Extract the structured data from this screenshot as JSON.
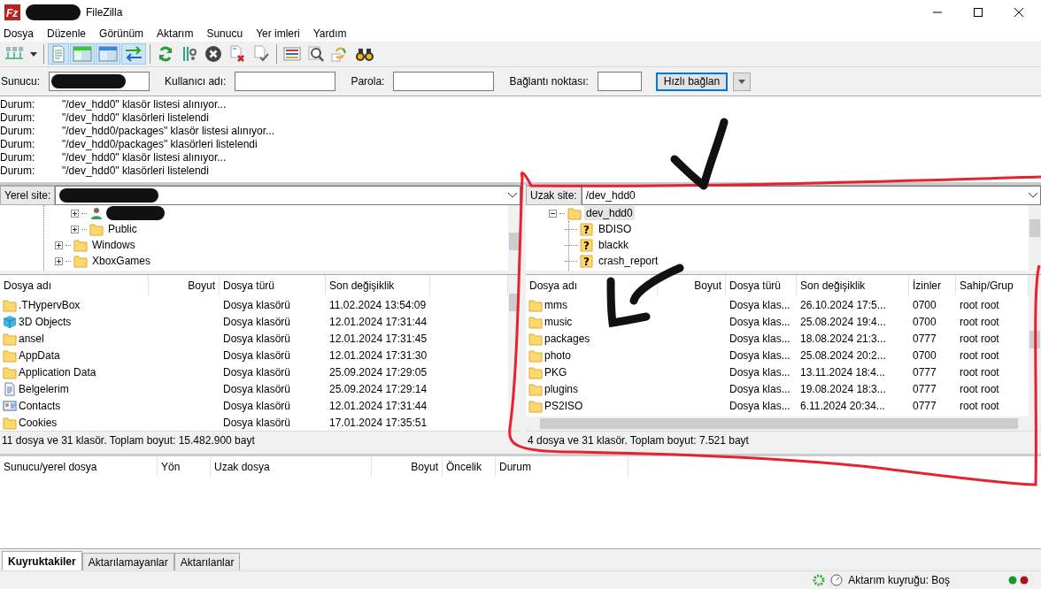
{
  "window": {
    "title": "FileZilla",
    "logo": "Fz"
  },
  "menu": [
    "Dosya",
    "Düzenle",
    "Görünüm",
    "Aktarım",
    "Sunucu",
    "Yer imleri",
    "Yardım"
  ],
  "toolbar": [
    {
      "kind": "sitemanager",
      "selected": false
    },
    {
      "kind": "dropdown",
      "selected": false
    },
    {
      "kind": "log",
      "selected": true
    },
    {
      "kind": "localtree",
      "selected": true
    },
    {
      "kind": "remotetree",
      "selected": true
    },
    {
      "kind": "queue",
      "selected": true
    },
    {
      "kind": "refresh",
      "selected": false
    },
    {
      "kind": "filter",
      "selected": false
    },
    {
      "kind": "cancel",
      "selected": false
    },
    {
      "kind": "disconnect",
      "selected": false
    },
    {
      "kind": "reconnect",
      "selected": false
    },
    {
      "kind": "listview",
      "selected": false
    },
    {
      "kind": "search",
      "selected": false
    },
    {
      "kind": "sync",
      "selected": false
    },
    {
      "kind": "binoculars",
      "selected": false
    }
  ],
  "quickconnect": {
    "fields": [
      {
        "label": "Sunucu:"
      },
      {
        "label": "Kullanıcı adı:"
      },
      {
        "label": "Parola:"
      },
      {
        "label": "Bağlantı noktası:"
      }
    ],
    "button": "Hızlı bağlan"
  },
  "log": [
    {
      "label": "Durum:",
      "text": "\"/dev_hdd0\" klasör listesi alınıyor..."
    },
    {
      "label": "Durum:",
      "text": "\"/dev_hdd0\" klasörleri listelendi"
    },
    {
      "label": "Durum:",
      "text": "\"/dev_hdd0/packages\" klasör listesi alınıyor..."
    },
    {
      "label": "Durum:",
      "text": "\"/dev_hdd0/packages\" klasörleri listelendi"
    },
    {
      "label": "Durum:",
      "text": "\"/dev_hdd0\" klasör listesi alınıyor..."
    },
    {
      "label": "Durum:",
      "text": "\"/dev_hdd0\" klasörleri listelendi"
    }
  ],
  "local": {
    "site_label": "Yerel site:",
    "tree": [
      {
        "children": [
          {
            "kind": "user",
            "expanded": false
          },
          {
            "label": "Public",
            "kind": "folder",
            "expanded": false
          }
        ]
      },
      {
        "label": "Windows",
        "kind": "folder",
        "expanded": false
      },
      {
        "label": "XboxGames",
        "kind": "folder",
        "expanded": false
      }
    ],
    "columns": [
      "Dosya adı",
      "Boyut",
      "Dosya türü",
      "Son değişiklik"
    ],
    "rows": [
      {
        "kind": "folder",
        "name": ".THypervBox",
        "size": "",
        "type": "Dosya klasörü",
        "modified": "11.02.2024 13:54:09"
      },
      {
        "kind": "cube",
        "name": "3D Objects",
        "size": "",
        "type": "Dosya klasörü",
        "modified": "12.01.2024 17:31:44"
      },
      {
        "kind": "folder",
        "name": "ansel",
        "size": "",
        "type": "Dosya klasörü",
        "modified": "12.01.2024 17:31:45"
      },
      {
        "kind": "folder",
        "name": "AppData",
        "size": "",
        "type": "Dosya klasörü",
        "modified": "12.01.2024 17:31:30"
      },
      {
        "kind": "folder",
        "name": "Application Data",
        "size": "",
        "type": "Dosya klasörü",
        "modified": "25.09.2024 17:29:05"
      },
      {
        "kind": "document",
        "name": "Belgelerim",
        "size": "",
        "type": "Dosya klasörü",
        "modified": "25.09.2024 17:29:14"
      },
      {
        "kind": "contact",
        "name": "Contacts",
        "size": "",
        "type": "Dosya klasörü",
        "modified": "12.01.2024 17:31:44"
      },
      {
        "kind": "folder",
        "name": "Cookies",
        "size": "",
        "type": "Dosya klasörü",
        "modified": "17.01.2024 17:35:51"
      }
    ],
    "status": "11 dosya ve 31 klasör. Toplam boyut: 15.482.900 bayt"
  },
  "remote": {
    "site_label": "Uzak site:",
    "path": "/dev_hdd0",
    "tree": [
      {
        "label": "dev_hdd0",
        "kind": "folder",
        "expanded": true,
        "selected": true,
        "children": [
          {
            "label": "BDISO",
            "kind": "unknown",
            "mark": "?"
          },
          {
            "label": "blackk",
            "kind": "unknown",
            "mark": "?"
          },
          {
            "label": "crash_report",
            "kind": "unknown",
            "mark": "?"
          }
        ]
      }
    ],
    "columns": [
      "Dosya adı",
      "Boyut",
      "Dosya türü",
      "Son değişiklik",
      "İzinler",
      "Sahip/Grup"
    ],
    "rows": [
      {
        "name": "mms",
        "size": "",
        "type": "Dosya klas...",
        "modified": "26.10.2024 17:5...",
        "perm": "0700",
        "owner": "root root"
      },
      {
        "name": "music",
        "size": "",
        "type": "Dosya klas...",
        "modified": "25.08.2024 19:4...",
        "perm": "0700",
        "owner": "root root"
      },
      {
        "name": "packages",
        "size": "",
        "type": "Dosya klas...",
        "modified": "18.08.2024 21:3...",
        "perm": "0777",
        "owner": "root root"
      },
      {
        "name": "photo",
        "size": "",
        "type": "Dosya klas...",
        "modified": "25.08.2024 20:2...",
        "perm": "0700",
        "owner": "root root"
      },
      {
        "name": "PKG",
        "size": "",
        "type": "Dosya klas...",
        "modified": "13.11.2024 18:4...",
        "perm": "0777",
        "owner": "root root"
      },
      {
        "name": "plugins",
        "size": "",
        "type": "Dosya klas...",
        "modified": "19.08.2024 18:3...",
        "perm": "0777",
        "owner": "root root"
      },
      {
        "name": "PS2ISO",
        "size": "",
        "type": "Dosya klas...",
        "modified": "6.11.2024 20:34...",
        "perm": "0777",
        "owner": "root root"
      }
    ],
    "status": "4 dosya ve 31 klasör. Toplam boyut: 7.521 bayt"
  },
  "queue": {
    "columns": [
      "Sunucu/yerel dosya",
      "Yön",
      "Uzak dosya",
      "Boyut",
      "Öncelik",
      "Durum"
    ]
  },
  "queue_tabs": [
    {
      "label": "Kuyruktakiler",
      "selected": true
    },
    {
      "label": "Aktarılamayanlar",
      "selected": false
    },
    {
      "label": "Aktarılanlar",
      "selected": false
    }
  ],
  "status_bar": {
    "queue": "Aktarım kuyruğu: Boş"
  }
}
